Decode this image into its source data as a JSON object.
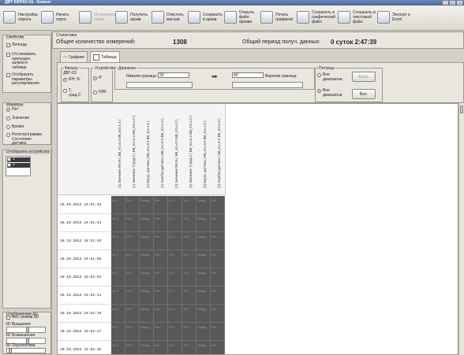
{
  "window": {
    "title": "ДВТ-03/ПАС-01 - Клиент",
    "minimize": "_",
    "maximize": "□",
    "close": "×"
  },
  "toolbar": [
    {
      "label": "Настройка опроса",
      "enabled": true
    },
    {
      "label": "Начать опрос",
      "enabled": true
    },
    {
      "label": "Остановить опрос",
      "enabled": false
    },
    {
      "label": "Получить архив",
      "enabled": true
    },
    {
      "label": "Очистить массив",
      "enabled": true
    },
    {
      "label": "Сохранить в архив",
      "enabled": true
    },
    {
      "label": "Открыть файл архива",
      "enabled": true
    },
    {
      "label": "Печать графиков",
      "enabled": true
    },
    {
      "label": "Сохранить в графический файл",
      "enabled": true
    },
    {
      "label": "Сохранить в текстовый файл",
      "enabled": true
    },
    {
      "label": "Экспорт в Excel",
      "enabled": true
    }
  ],
  "left": {
    "props_title": "Свойства",
    "legend": "Легенда",
    "show_omissions": "Отслеживать пропущен. записи в таблице",
    "show_params": "Отобразить параметры регулирования",
    "markers_title": "Маркеры",
    "markers": [
      {
        "label": "Нет",
        "on": true
      },
      {
        "label": "Значение",
        "on": false
      },
      {
        "label": "Время",
        "on": false
      },
      {
        "label": "Регистрограмма Состояние датчика",
        "on": false
      }
    ],
    "devices_title": "Отобразить устройства",
    "devices": [
      "1",
      "2"
    ],
    "view3d_title": "Отображение 3D",
    "view3d_toggle": "Вкл. режим 3D",
    "rotate": "3D Вращение",
    "elevation": "3D Возвышение",
    "perspective": "3D Перспектива"
  },
  "stats": {
    "title": "Статистика",
    "count_label": "Общее количество измерений:",
    "count_value": "1308",
    "period_label": "Общий период получ. данных:",
    "period_value": "0 суток  2:47:39"
  },
  "tabs": [
    {
      "label": "Графики",
      "active": false
    },
    {
      "label": "Таблица",
      "active": true
    }
  ],
  "filters": {
    "filter_title": "Фильтр",
    "filter_sub": "ДВТ-03",
    "filter_opts": [
      {
        "label": "RH, %",
        "on": true
      },
      {
        "label": "T, град.С",
        "on": false
      }
    ],
    "units_title": "Устройство",
    "units_opts": [
      {
        "label": "Н",
        "on": true
      },
      {
        "label": "Н/М",
        "on": false
      }
    ],
    "range_title": "Диапазон",
    "lower_label": "Нижняя граница",
    "lower_value": "20",
    "upper_label": "Верхняя граница",
    "upper_value": "40",
    "hyst_title": "Пятница",
    "hyst_opts": [
      {
        "label": "Вне диапазона",
        "on": false
      },
      {
        "label": "Вне диапазона",
        "on": true
      }
    ],
    "off_button": "Выкл.",
    "on_button": "Вкл."
  },
  "table": {
    "headers": [
      "(1) Значение RH,% ( BB_K1=0.0 BB_K2=1.0 )",
      "(1) Значение T,град.C ( BB_K1=0.0 BB_K2=1.0 )",
      "(1) Внутр. датчика ( BB_K1=0.0 BB_K2=1.0 )",
      "(1) Ошибка датчика ( BB_K1=0.0 BB_K2=1.0 )",
      "(2) Значение RH,% ( BB_K1=0.0 BB_K2=1.0 )",
      "(2) Значение T,град.C ( BB_K1=0.0 BB_K2=1.0 )",
      "(2) Внутр. датчика ( BB_K1=0.0 BB_K2=1.0 )",
      "(2) Ошибка датчика ( BB_K1=0.0 BB_K2=1.0 )"
    ],
    "rows": [
      {
        "time": "10.10.2012 10:51:33",
        "cells": [
          "42,3",
          "20,3",
          "Завод.",
          "Нет",
          "42,1",
          "20,6",
          "Завод.",
          "Нет"
        ]
      },
      {
        "time": "10.10.2012 10:51:41",
        "cells": [
          "42,3",
          "20,3",
          "Завод.",
          "Нет",
          "42,1",
          "20,6",
          "Завод.",
          "Нет"
        ]
      },
      {
        "time": "10.10.2012 10:51:49",
        "cells": [
          "42,3",
          "20,3",
          "Завод.",
          "Нет",
          "42,1",
          "20,6",
          "Завод.",
          "Нет"
        ]
      },
      {
        "time": "10.10.2012 10:51:56",
        "cells": [
          "42,3",
          "20,3",
          "Завод.",
          "Нет",
          "42,1",
          "20,6",
          "Завод.",
          "Нет"
        ]
      },
      {
        "time": "10.10.2012 10:52:03",
        "cells": [
          "42,3",
          "20,3",
          "Завод.",
          "Нет",
          "42,1",
          "20,6",
          "Завод.",
          "Нет"
        ]
      },
      {
        "time": "10.10.2012 10:52:11",
        "cells": [
          "42,3",
          "20,3",
          "Завод.",
          "Нет",
          "42,1",
          "20,6",
          "Завод.",
          "Нет"
        ]
      },
      {
        "time": "10.10.2012 10:52:19",
        "cells": [
          "42,3",
          "20,3",
          "Завод.",
          "Нет",
          "42,1",
          "20,6",
          "Завод.",
          "Нет"
        ]
      },
      {
        "time": "10.10.2012 10:52:27",
        "cells": [
          "42,3",
          "20,3",
          "Завод.",
          "Нет",
          "42,1",
          "20,6",
          "Завод.",
          "Нет"
        ]
      },
      {
        "time": "10.10.2012 10:52:35",
        "cells": [
          "42,3",
          "20,3",
          "Завод.",
          "Нет",
          "42,1",
          "20,6",
          "Завод.",
          "Нет"
        ]
      }
    ]
  }
}
